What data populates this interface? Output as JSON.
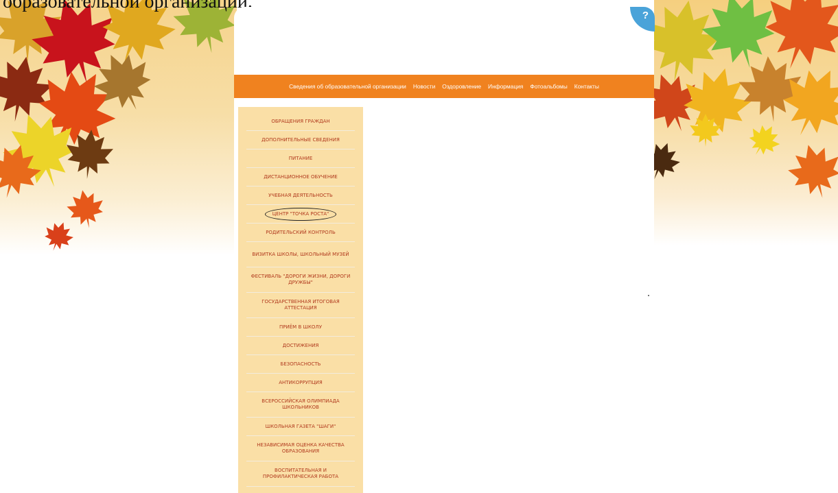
{
  "top_caption": "образовательной организации.",
  "help_badge": "?",
  "nav": {
    "items": [
      "Сведения об образовательной организации",
      "Новости",
      "Оздоровление",
      "Информация",
      "Фотоальбомы",
      "Контакты"
    ]
  },
  "sidebar": {
    "items": [
      "ОБРАЩЕНИЯ ГРАЖДАН",
      "ДОПОЛНИТЕЛЬНЫЕ СВЕДЕНИЯ",
      "ПИТАНИЕ",
      "ДИСТАНЦИОННОЕ ОБУЧЕНИЕ",
      "УЧЕБНАЯ ДЕЯТЕЛЬНОСТЬ",
      "ЦЕНТР \"ТОЧКА РОСТА\"",
      "РОДИТЕЛЬСКИЙ КОНТРОЛЬ",
      "ВИЗИТКА ШКОЛЫ, ШКОЛЬНЫЙ МУЗЕЙ",
      "ФЕСТИВАЛЬ \"ДОРОГИ ЖИЗНИ, ДОРОГИ ДРУЖБЫ\"",
      "ГОСУДАРСТВЕННАЯ ИТОГОВАЯ АТТЕСТАЦИЯ",
      "ПРИЁМ В ШКОЛУ",
      "ДОСТИЖЕНИЯ",
      "БЕЗОПАСНОСТЬ",
      "АНТИКОРРУПЦИЯ",
      "ВСЕРОССИЙСКАЯ ОЛИМПИАДА ШКОЛЬНИКОВ",
      "ШКОЛЬНАЯ ГАЗЕТА \"ШАГИ\"",
      "НЕЗАВИСИМАЯ ОЦЕНКА КАЧЕСТВА ОБРАЗОВАНИЯ",
      "ВОСПИТАТЕЛЬНАЯ И ПРОФИЛАКТИЧЕСКАЯ РАБОТА"
    ]
  },
  "colors": {
    "nav_bg": "#f0821f",
    "sidebar_bg": "#fadfa6",
    "sidebar_text": "#b13a1e",
    "help_badge": "#4aa3d9"
  },
  "icons": [
    "maple-leaf-icon",
    "help-icon"
  ]
}
